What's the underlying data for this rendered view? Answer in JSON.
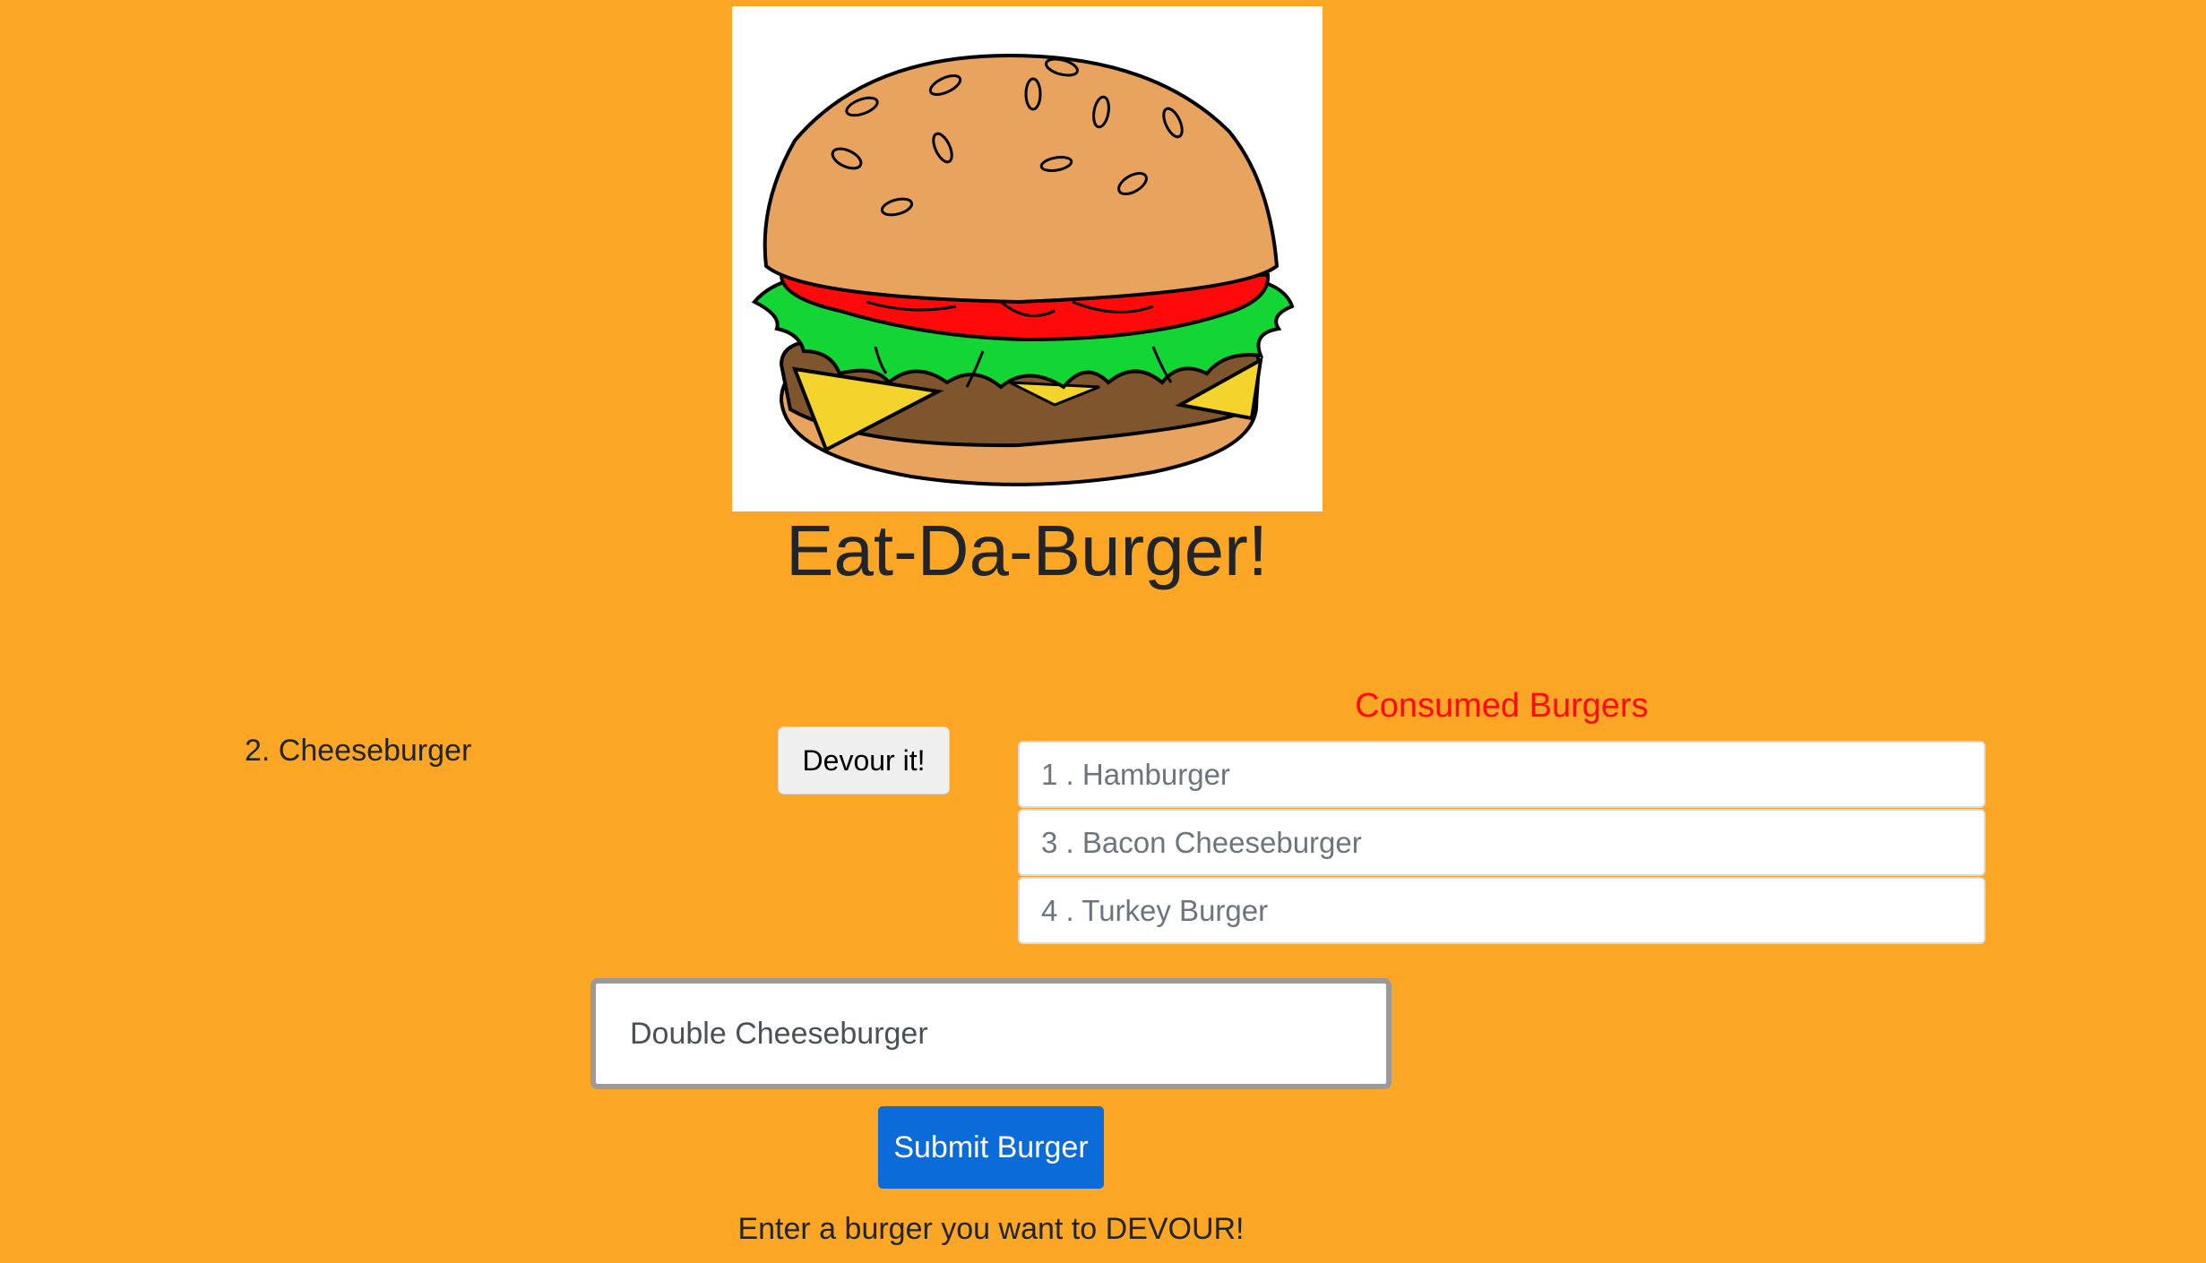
{
  "theme": {
    "background": "#fba624",
    "consumed_title_color": "#ff0a0a",
    "submit_button_color": "#0b6bd8"
  },
  "header": {
    "logo_icon": "burger-illustration",
    "title": "Eat-Da-Burger!"
  },
  "uneaten": {
    "items": [
      {
        "label": "2. Cheeseburger",
        "button_label": "Devour it!"
      }
    ]
  },
  "consumed": {
    "title": "Consumed Burgers",
    "items": [
      {
        "label": "1 . Hamburger"
      },
      {
        "label": "3 . Bacon Cheeseburger"
      },
      {
        "label": "4 . Turkey Burger"
      }
    ]
  },
  "form": {
    "input_value": "Double Cheeseburger",
    "submit_label": "Submit Burger",
    "helper_text": "Enter a burger you want to DEVOUR!"
  }
}
